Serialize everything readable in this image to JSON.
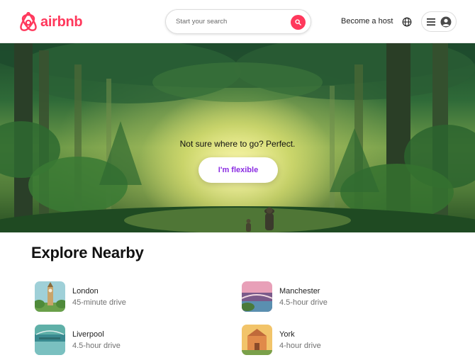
{
  "header": {
    "logo_text": "airbnb",
    "search_placeholder": "Start your search",
    "host_link": "Become a host"
  },
  "hero": {
    "title": "Not sure where to go? Perfect.",
    "button_label": "I'm flexible"
  },
  "explore": {
    "title": "Explore Nearby",
    "places": [
      {
        "name": "London",
        "distance": "45-minute drive"
      },
      {
        "name": "Manchester",
        "distance": "4.5-hour drive"
      },
      {
        "name": "Liverpool",
        "distance": "4.5-hour drive"
      },
      {
        "name": "York",
        "distance": "4-hour drive"
      }
    ]
  },
  "colors": {
    "brand": "#ff385c",
    "accent_text": "#8a2be2"
  },
  "icons": [
    "airbnb-logo-icon",
    "search-icon",
    "globe-icon",
    "hamburger-menu-icon",
    "user-avatar-icon"
  ]
}
